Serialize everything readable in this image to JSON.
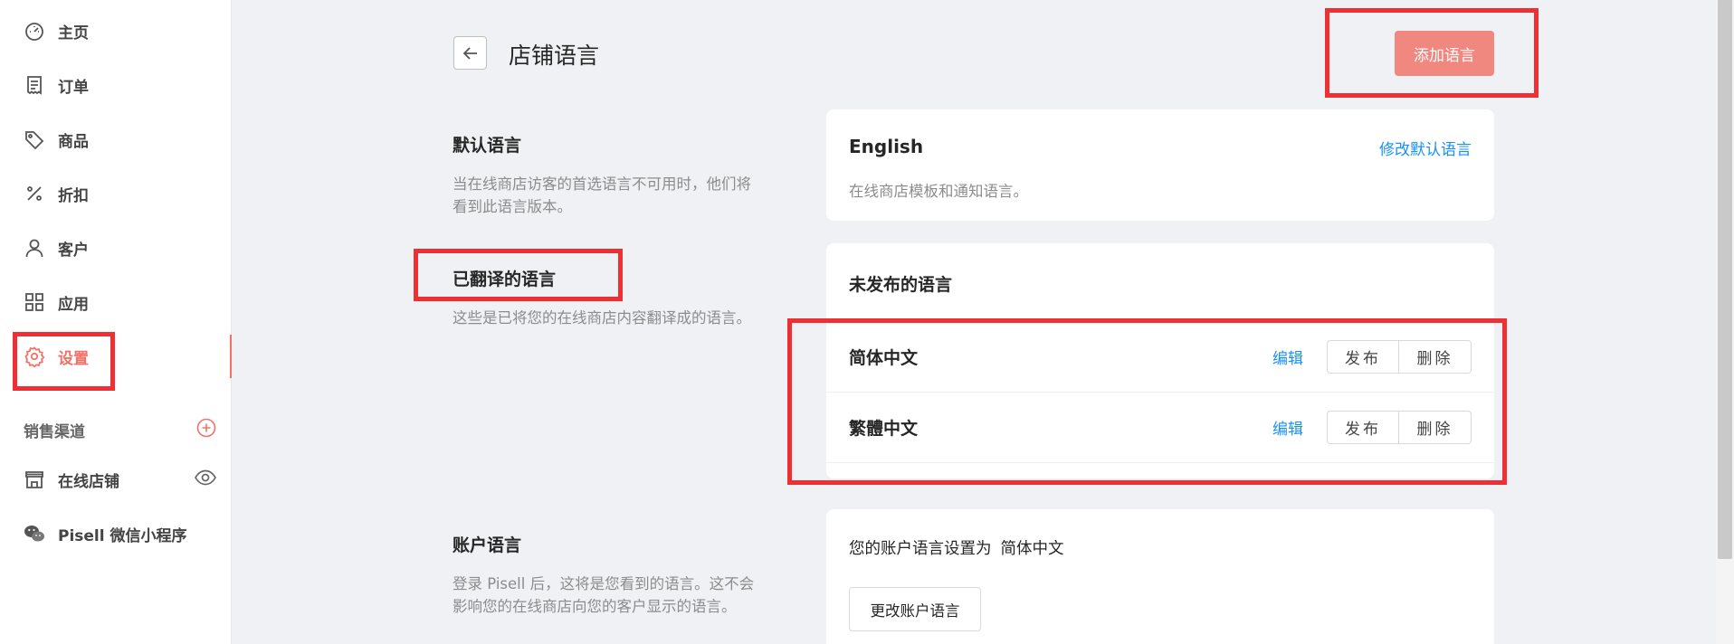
{
  "sidebar": {
    "items": [
      {
        "label": "主页",
        "icon": "dashboard-icon"
      },
      {
        "label": "订单",
        "icon": "receipt-icon"
      },
      {
        "label": "商品",
        "icon": "tag-icon"
      },
      {
        "label": "折扣",
        "icon": "percent-icon"
      },
      {
        "label": "客户",
        "icon": "user-icon"
      },
      {
        "label": "应用",
        "icon": "apps-icon"
      },
      {
        "label": "设置",
        "icon": "gear-icon",
        "active": true
      }
    ],
    "channels_title": "销售渠道",
    "channels": [
      {
        "label": "在线店铺",
        "icon": "store-icon"
      },
      {
        "label": "Pisell 微信小程序",
        "icon": "wechat-icon"
      }
    ]
  },
  "header": {
    "title": "店铺语言",
    "add_button": "添加语言"
  },
  "default_language": {
    "heading": "默认语言",
    "description": "当在线商店访客的首选语言不可用时，他们将 看到此语言版本。",
    "value": "English",
    "change_link": "修改默认语言",
    "note": "在线商店模板和通知语言。"
  },
  "translated_languages": {
    "heading": "已翻译的语言",
    "description": "这些是已将您的在线商店内容翻译成的语言。",
    "card_title": "未发布的语言",
    "rows": [
      {
        "name": "简体中文",
        "edit": "编辑",
        "publish": "发布",
        "delete": "删除"
      },
      {
        "name": "繁體中文",
        "edit": "编辑",
        "publish": "发布",
        "delete": "删除"
      }
    ]
  },
  "account_language": {
    "heading": "账户语言",
    "description": "登录 Pisell 后，这将是您看到的语言。这不会影响您的在线商店向您的客户显示的语言。",
    "text": "您的账户语言设置为",
    "value": "简体中文",
    "button": "更改账户语言"
  },
  "colors": {
    "accent": "#f07268",
    "link": "#1890ff",
    "highlight": "#ee3035"
  }
}
